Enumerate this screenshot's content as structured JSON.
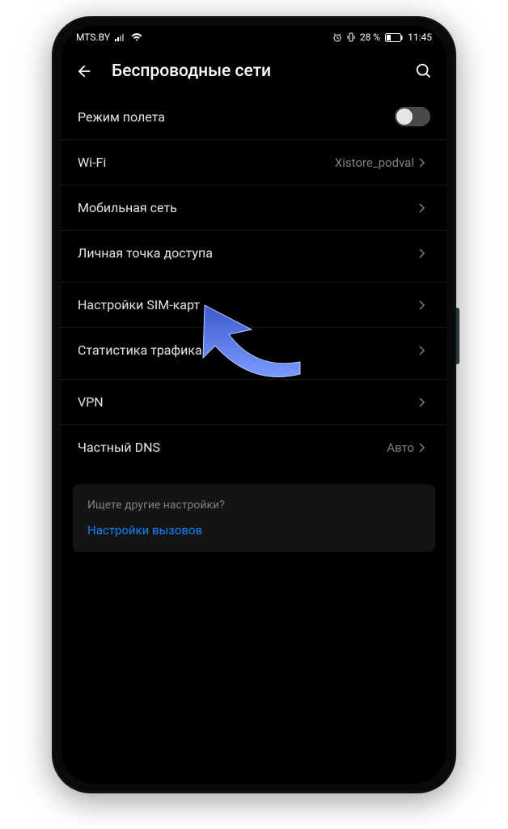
{
  "status_bar": {
    "carrier": "MTS.BY",
    "battery_text": "28 %",
    "time": "11:45"
  },
  "header": {
    "title": "Беспроводные сети"
  },
  "rows": {
    "airplane": "Режим полета",
    "wifi": "Wi-Fi",
    "wifi_value": "Xistore_podval",
    "mobile": "Мобильная сеть",
    "hotspot": "Личная точка доступа",
    "sim": "Настройки SIM-карт",
    "traffic": "Статистика трафика",
    "vpn": "VPN",
    "dns": "Частный DNS",
    "dns_value": "Авто"
  },
  "help": {
    "title": "Ищете другие настройки?",
    "link": "Настройки вызовов"
  }
}
